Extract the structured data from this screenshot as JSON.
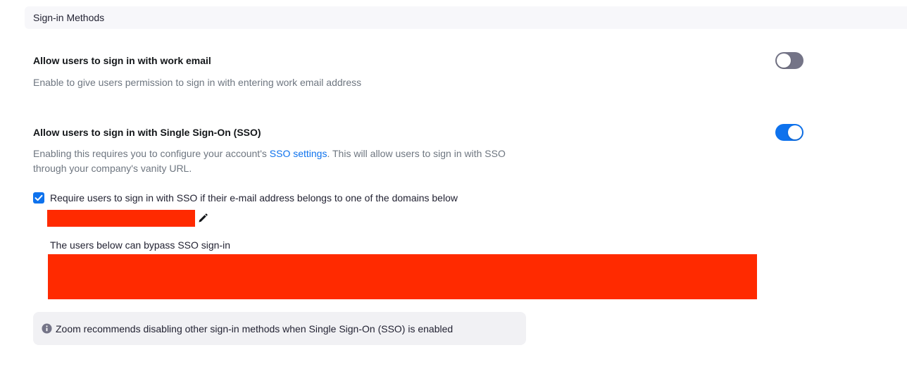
{
  "section": {
    "title": "Sign-in Methods"
  },
  "work_email": {
    "title": "Allow users to sign in with work email",
    "description": "Enable to give users permission to sign in with entering work email address",
    "enabled": false
  },
  "sso": {
    "title": "Allow users to sign in with Single Sign-On (SSO)",
    "description_before": "Enabling this requires you to configure your account's ",
    "description_link": "SSO settings",
    "description_after_line1": ". This will allow users to sign in with SSO",
    "description_line2": "through your company's vanity URL.",
    "enabled": true,
    "require_checkbox_label": "Require users to sign in with SSO if their e-mail address belongs to one of the domains below",
    "require_checked": true,
    "bypass_label": "The users below can bypass SSO sign-in"
  },
  "info": {
    "text": "Zoom recommends disabling other sign-in methods when Single Sign-On (SSO) is enabled"
  },
  "colors": {
    "accent": "#0e72ed",
    "toggle_off": "#747487",
    "redaction": "#ff2a00",
    "info_bg": "#f1f1f4"
  },
  "icons": {
    "edit": "pencil-icon",
    "info": "info-icon",
    "check": "checkmark-icon"
  }
}
